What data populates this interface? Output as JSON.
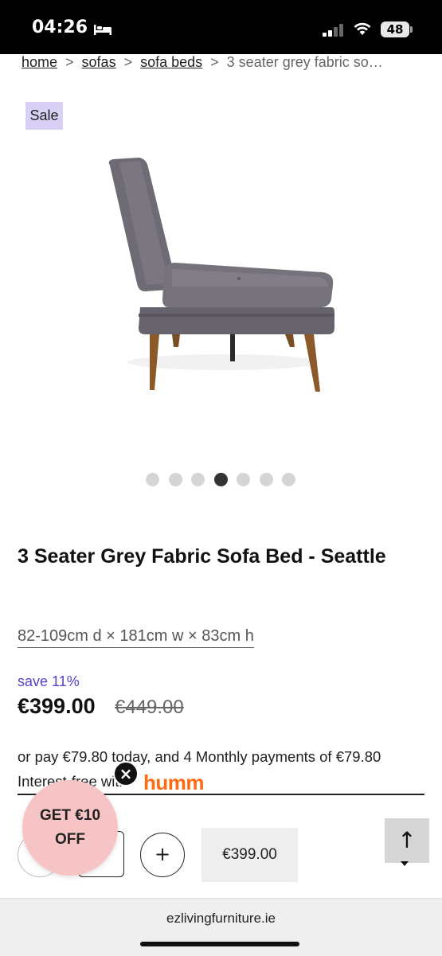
{
  "status_bar": {
    "time": "04:26",
    "battery": "48",
    "icons": [
      "bed-icon",
      "signal-icon",
      "wifi-icon",
      "battery-icon"
    ]
  },
  "breadcrumb": {
    "items": [
      "home",
      "sofas",
      "sofa beds"
    ],
    "separator": ">",
    "current": "3 seater grey fabric so…"
  },
  "badge": {
    "sale": "Sale"
  },
  "gallery": {
    "dot_count": 7,
    "active_index": 3
  },
  "product": {
    "title": "3 Seater Grey Fabric Sofa Bed - Seattle",
    "dimensions": "82-109cm d × 181cm w × 83cm h",
    "save": "save 11%",
    "price": "€399.00",
    "old_price": "€449.00"
  },
  "payment": {
    "line1": "or pay €79.80 today, and 4 Monthly payments of €79.80",
    "line2": "Interest-free with",
    "provider": "humm",
    "provider_color": "#ff6a13"
  },
  "cart": {
    "plus_label": "+",
    "button_price": "€399.00"
  },
  "promo": {
    "line1": "GET €10",
    "line2": "OFF",
    "close": "×"
  },
  "scroll_top": {
    "arrow": "↑"
  },
  "url_bar": {
    "url": "ezlivingfurniture.ie"
  },
  "colors": {
    "sale_badge": "#d9d0f6",
    "save_text": "#5a3fc7",
    "promo_bg": "#f6c4c4",
    "status_bar": "#000000"
  }
}
